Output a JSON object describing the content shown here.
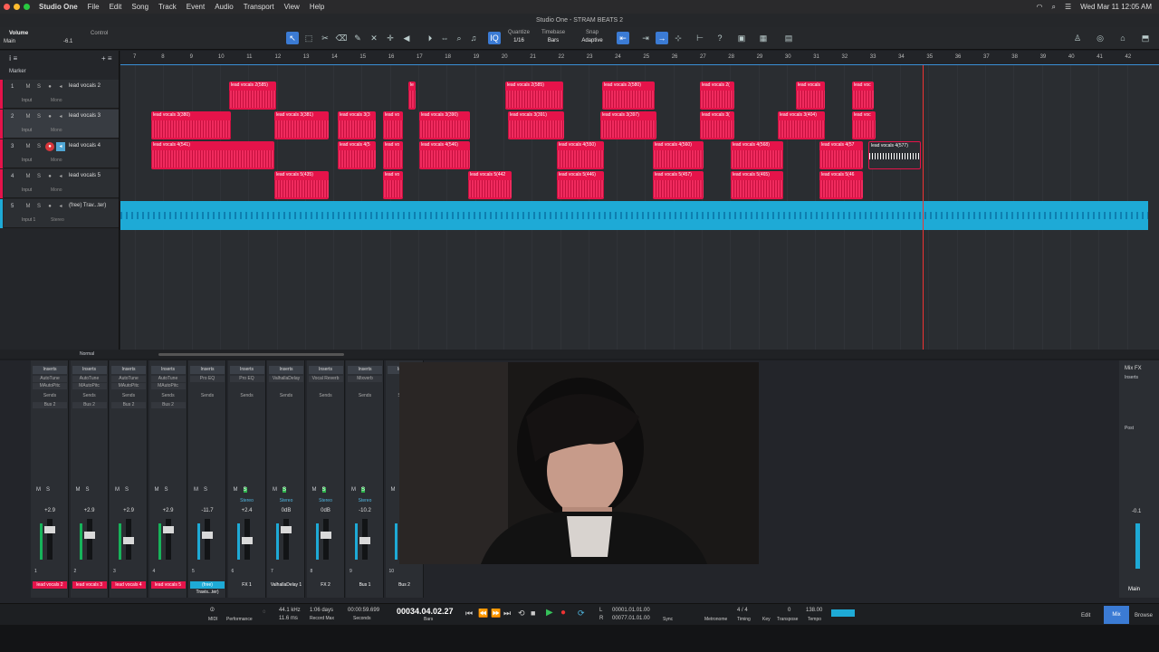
{
  "menubar": {
    "app": "Studio One",
    "items": [
      "File",
      "Edit",
      "Song",
      "Track",
      "Event",
      "Audio",
      "Transport",
      "View",
      "Help"
    ],
    "clock": "Wed Mar 11  12:05 AM"
  },
  "window": {
    "title": "Studio One - STRAM BEATS 2"
  },
  "toolbar": {
    "volume_label": "Volume",
    "control_label": "Control",
    "main_label": "Main",
    "main_value": "-6.1",
    "quantize_label": "Quantize",
    "quantize_value": "1/16",
    "timebase_label": "Timebase",
    "timebase_value": "Bars",
    "snap_label": "Snap",
    "snap_value": "Adaptive"
  },
  "ruler": {
    "bars": [
      "7",
      "8",
      "9",
      "10",
      "11",
      "12",
      "13",
      "14",
      "15",
      "16",
      "17",
      "18",
      "19",
      "20",
      "21",
      "22",
      "23",
      "24",
      "25",
      "26",
      "27",
      "28",
      "29",
      "30",
      "31",
      "32",
      "33",
      "34",
      "35",
      "36",
      "37",
      "38",
      "39",
      "40",
      "41",
      "42"
    ]
  },
  "marker_label": "Marker",
  "tracks": [
    {
      "num": "1",
      "name": "lead vocals 2",
      "input": "Input",
      "mode": "Mono"
    },
    {
      "num": "2",
      "name": "lead vocals 3",
      "input": "Input",
      "mode": "Mono"
    },
    {
      "num": "3",
      "name": "lead vocals 4",
      "input": "Input",
      "mode": "Mono"
    },
    {
      "num": "4",
      "name": "lead vocals 5",
      "input": "Input",
      "mode": "Mono"
    },
    {
      "num": "5",
      "name": "(free) Trav...ter)",
      "input": "Input 1",
      "mode": "Stereo"
    }
  ],
  "clips": {
    "t1": [
      "lead vocals 2(585)",
      "le",
      "lead vocals 2(585)",
      "lead vocals 2(580)",
      "lead vocals 2(",
      "lead vocals",
      "lead voc"
    ],
    "t2": [
      "lead vocals 3(380)",
      "lead vocals 3(381)",
      "lead vocals 3(3",
      "lead vo",
      "lead vocals 3(390)",
      "lead vocals 3(391)",
      "lead vocals 3(397)",
      "lead vocals 3(",
      "lead vocals 3(404)",
      "lead voc"
    ],
    "t3": [
      "lead vocals 4(541)",
      "lead vocals 4(5",
      "lead vo",
      "lead vocals 4(546)",
      "lead vocals 4(550)",
      "lead vocals 4(560)",
      "lead vocals 4(568)",
      "lead vocals 4(57",
      "lead vocals 4(577)"
    ],
    "t4": [
      "lead vocals 5(435)",
      "lead vo",
      "lead vocals 5(442",
      "lead vocals 5(446)",
      "lead vocals 5(457)",
      "lead vocals 5(465)",
      "lead vocals 5(46"
    ]
  },
  "hscroll": {
    "mode": "Normal"
  },
  "mixer": {
    "insert_label": "Inserts",
    "send_label": "Sends",
    "stereo_label": "Stereo",
    "mixfx_label": "Mix FX",
    "post_label": "Post",
    "main_vol": "-0.1",
    "main_name": "Main",
    "channels": [
      {
        "name": "lead vocals 2",
        "vol": "+2.9",
        "num": "1",
        "plugins": [
          "AutoTune",
          "MAutoPitc"
        ],
        "bus": "Bus 2"
      },
      {
        "name": "lead vocals 3",
        "vol": "+2.9",
        "num": "2",
        "plugins": [
          "AutoTune",
          "MAutoPitc"
        ],
        "bus": "Bus 2"
      },
      {
        "name": "lead vocals 4",
        "vol": "+2.9",
        "num": "3",
        "plugins": [
          "AutoTune",
          "MAutoPitc"
        ],
        "bus": "Bus 2"
      },
      {
        "name": "lead vocals 5",
        "vol": "+2.9",
        "num": "4",
        "plugins": [
          "AutoTune",
          "MAutoPitc"
        ],
        "bus": "Bus 2"
      },
      {
        "name": "(free) Travis...ter)",
        "vol": "-11.7",
        "num": "5",
        "plugins": [
          "Pro EQ"
        ],
        "bus": ""
      },
      {
        "name": "FX 1",
        "vol": "+2.4",
        "num": "6",
        "plugins": [
          "Pro EQ"
        ],
        "bus": ""
      },
      {
        "name": "ValhallaDelay 1",
        "vol": "0dB",
        "num": "7",
        "plugins": [
          "ValhallaDelay"
        ],
        "bus": ""
      },
      {
        "name": "FX 2",
        "vol": "0dB",
        "num": "8",
        "plugins": [
          "Vocal Reverb"
        ],
        "bus": ""
      },
      {
        "name": "Bus 1",
        "vol": "-10.2",
        "num": "9",
        "plugins": [
          "Mixverb"
        ],
        "bus": ""
      },
      {
        "name": "Bus 2",
        "vol": "",
        "num": "10",
        "plugins": [],
        "bus": ""
      }
    ]
  },
  "transport": {
    "samplerate": "44.1 kHz",
    "latency": "11.6 ms",
    "days": "1:06 days",
    "record_max": "Record Max",
    "seconds_value": "00:00:59.699",
    "seconds_label": "Seconds",
    "position": "00034.04.02.27",
    "bars_label": "Bars",
    "l_pos": "00001.01.01.00",
    "r_pos": "00077.01.01.00",
    "sync": "Sync",
    "metronome": "Metronome",
    "signature": "4 / 4",
    "timing": "Timing",
    "key": "Key",
    "transpose_val": "0",
    "transpose": "Transpose",
    "tempo_val": "138.00",
    "tempo": "Tempo",
    "midi": "MIDI",
    "performance": "Performance",
    "edit": "Edit",
    "mix": "Mix",
    "browse": "Browse"
  },
  "colors": {
    "clip": "#e5134a",
    "audio": "#1eaad6",
    "accent": "#3b7bd4"
  }
}
